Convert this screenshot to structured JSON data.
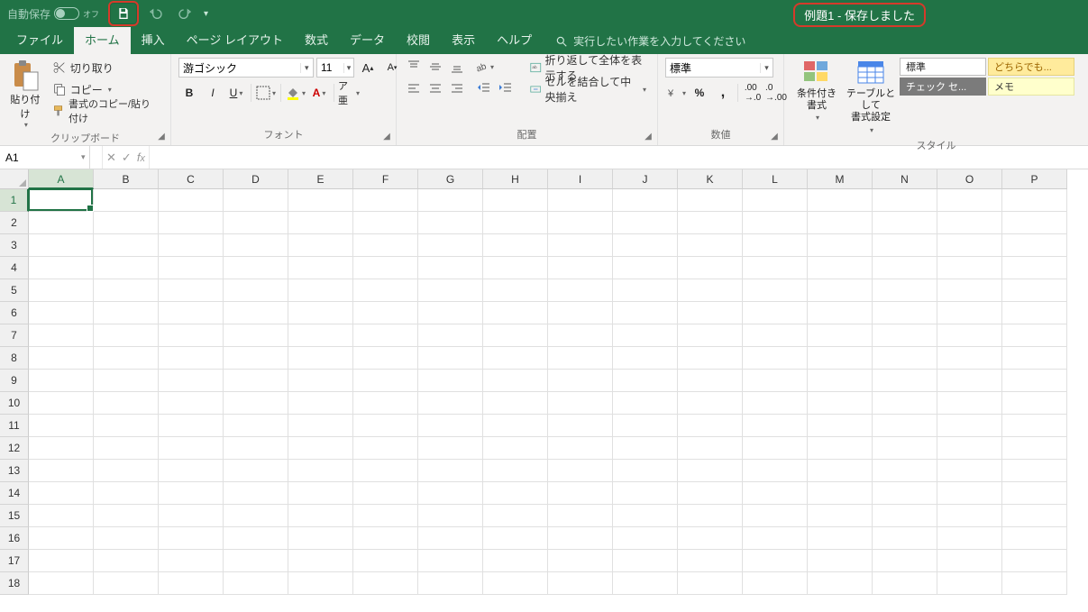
{
  "titlebar": {
    "autosave_label": "自動保存",
    "autosave_state": "オフ",
    "document": "例題1",
    "separator": "-",
    "status": "保存しました"
  },
  "tabs": {
    "file": "ファイル",
    "home": "ホーム",
    "insert": "挿入",
    "pagelayout": "ページ レイアウト",
    "formulas": "数式",
    "data": "データ",
    "review": "校閲",
    "view": "表示",
    "help": "ヘルプ",
    "tellme": "実行したい作業を入力してください"
  },
  "ribbon": {
    "clipboard": {
      "label": "クリップボード",
      "paste": "貼り付け",
      "cut": "切り取り",
      "copy": "コピー",
      "format_painter": "書式のコピー/貼り付け"
    },
    "font": {
      "label": "フォント",
      "name": "游ゴシック",
      "size": "11"
    },
    "alignment": {
      "label": "配置",
      "wrap": "折り返して全体を表示する",
      "merge": "セルを結合して中央揃え"
    },
    "number": {
      "label": "数値",
      "format": "標準"
    },
    "styles": {
      "label": "スタイル",
      "conditional": "条件付き\n書式",
      "table": "テーブルとして\n書式設定",
      "style1": "標準",
      "style2": "どちらでも...",
      "style3": "チェック セ...",
      "style4": "メモ"
    }
  },
  "formula_bar": {
    "namebox": "A1",
    "formula": ""
  },
  "grid": {
    "columns": [
      "A",
      "B",
      "C",
      "D",
      "E",
      "F",
      "G",
      "H",
      "I",
      "J",
      "K",
      "L",
      "M",
      "N",
      "O",
      "P"
    ],
    "rows": [
      1,
      2,
      3,
      4,
      5,
      6,
      7,
      8,
      9,
      10,
      11,
      12,
      13,
      14,
      15,
      16,
      17,
      18
    ],
    "active": {
      "col": "A",
      "row": 1
    }
  }
}
